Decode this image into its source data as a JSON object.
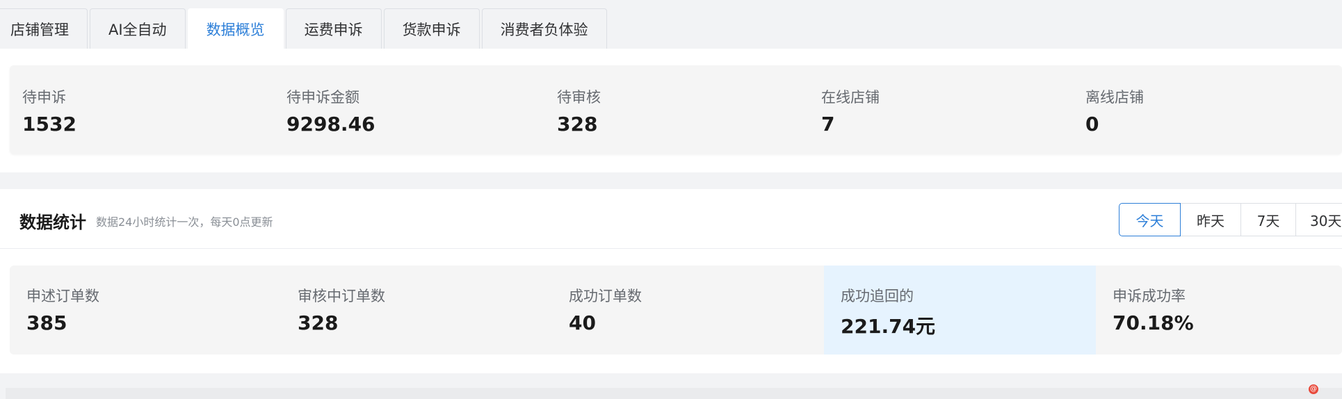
{
  "tabs": [
    {
      "label": "店铺管理"
    },
    {
      "label": "AI全自动"
    },
    {
      "label": "数据概览"
    },
    {
      "label": "运费申诉"
    },
    {
      "label": "货款申诉"
    },
    {
      "label": "消费者负体验"
    }
  ],
  "active_tab": "数据概览",
  "summary": {
    "items": [
      {
        "label": "待申诉",
        "value": "1532"
      },
      {
        "label": "待申诉金额",
        "value": "9298.46"
      },
      {
        "label": "待审核",
        "value": "328"
      },
      {
        "label": "在线店铺",
        "value": "7"
      },
      {
        "label": "离线店铺",
        "value": "0"
      }
    ]
  },
  "stats": {
    "title": "数据统计",
    "subtitle": "数据24小时统计一次，每天0点更新",
    "ranges": [
      "今天",
      "昨天",
      "7天",
      "30天"
    ],
    "active_range": "今天",
    "items": [
      {
        "label": "申述订单数",
        "value": "385"
      },
      {
        "label": "审核中订单数",
        "value": "328"
      },
      {
        "label": "成功订单数",
        "value": "40"
      },
      {
        "label": "成功追回的",
        "value": "221.74元"
      },
      {
        "label": "申诉成功率",
        "value": "70.18%"
      }
    ]
  },
  "corner_mark": "@",
  "colors": {
    "accent": "#2d7fd8",
    "highlight_bg": "#e6f3fe",
    "page_bg": "#f2f3f5",
    "card_bg": "#f5f5f5"
  }
}
